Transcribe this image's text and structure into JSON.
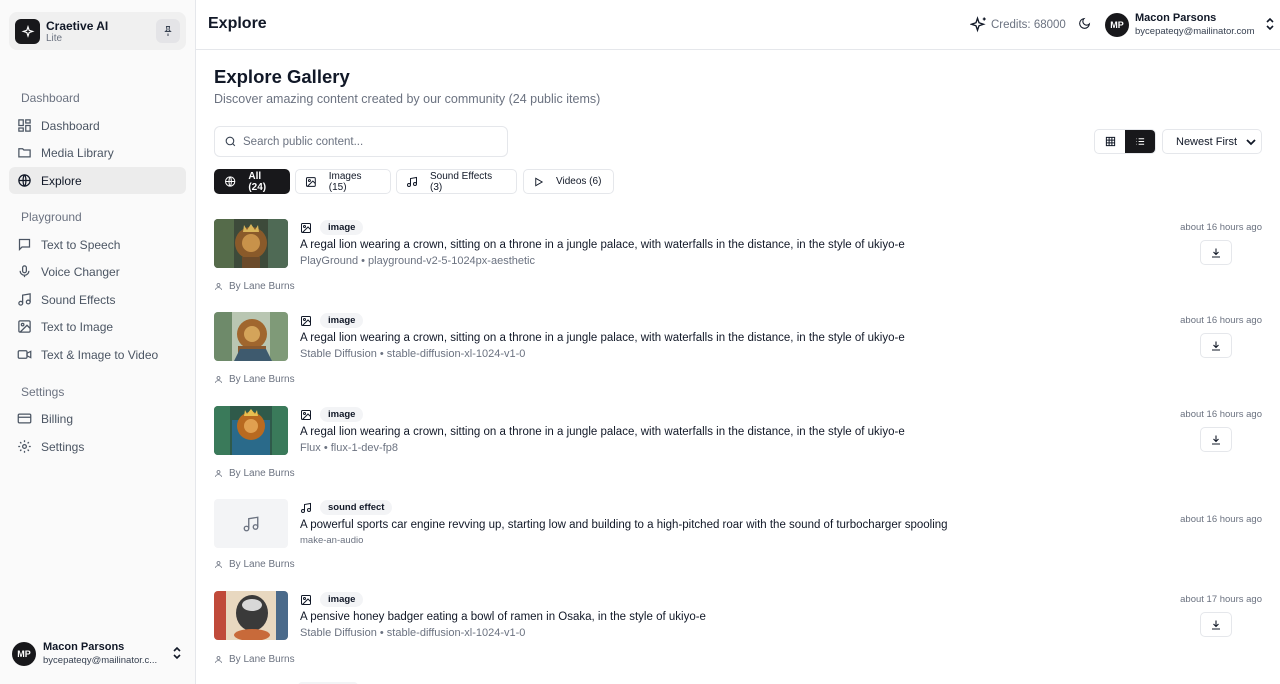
{
  "brand": {
    "name": "Craetive AI",
    "plan": "Lite"
  },
  "sidebar": {
    "sections": [
      {
        "label": "Dashboard",
        "items": [
          {
            "label": "Dashboard",
            "icon": "dashboard-icon"
          },
          {
            "label": "Media Library",
            "icon": "folder-icon"
          },
          {
            "label": "Explore",
            "icon": "globe-icon",
            "active": true
          }
        ]
      },
      {
        "label": "Playground",
        "items": [
          {
            "label": "Text to Speech",
            "icon": "message-icon"
          },
          {
            "label": "Voice Changer",
            "icon": "mic-icon"
          },
          {
            "label": "Sound Effects",
            "icon": "music-icon"
          },
          {
            "label": "Text to Image",
            "icon": "image-icon"
          },
          {
            "label": "Text & Image to Video",
            "icon": "video-icon"
          }
        ]
      },
      {
        "label": "Settings",
        "items": [
          {
            "label": "Billing",
            "icon": "credit-card-icon"
          },
          {
            "label": "Settings",
            "icon": "gear-icon"
          }
        ]
      }
    ]
  },
  "user": {
    "initials": "MP",
    "name": "Macon Parsons",
    "email": "bycepateqy@mailinator.com",
    "email_short": "bycepateqy@mailinator.c..."
  },
  "header": {
    "title": "Explore",
    "credits": "Credits: 68000"
  },
  "gallery": {
    "title": "Explore Gallery",
    "subtitle": "Discover amazing content created by our community (24 public items)",
    "search_placeholder": "Search public content...",
    "sort": "Newest First",
    "filters": [
      {
        "label": "All (24)",
        "icon": "globe-icon",
        "active": true
      },
      {
        "label": "Images (15)",
        "icon": "image-icon"
      },
      {
        "label": "Sound Effects (3)",
        "icon": "music-icon"
      },
      {
        "label": "Videos (6)",
        "icon": "play-icon"
      }
    ]
  },
  "items": [
    {
      "type": "image",
      "prompt": "A regal lion wearing a crown, sitting on a throne in a jungle palace, with waterfalls in the distance, in the style of ukiyo-e",
      "meta": "PlayGround • playground-v2-5-1024px-aesthetic",
      "author": "By Lane Burns",
      "time": "about 16 hours ago"
    },
    {
      "type": "image",
      "prompt": "A regal lion wearing a crown, sitting on a throne in a jungle palace, with waterfalls in the distance, in the style of ukiyo-e",
      "meta": "Stable Diffusion • stable-diffusion-xl-1024-v1-0",
      "author": "By Lane Burns",
      "time": "about 16 hours ago"
    },
    {
      "type": "image",
      "prompt": "A regal lion wearing a crown, sitting on a throne in a jungle palace, with waterfalls in the distance, in the style of ukiyo-e",
      "meta": "Flux • flux-1-dev-fp8",
      "author": "By Lane Burns",
      "time": "about 16 hours ago"
    },
    {
      "type": "sound effect",
      "prompt": "A powerful sports car engine revving up, starting low and building to a high-pitched roar with the sound of turbocharger spooling",
      "meta": "make-an-audio",
      "author": "By Lane Burns",
      "time": "about 16 hours ago"
    },
    {
      "type": "image",
      "prompt": "A pensive honey badger eating a bowl of ramen in Osaka, in the style of ukiyo-e",
      "meta": "Stable Diffusion • stable-diffusion-xl-1024-v1-0",
      "author": "By Lane Burns",
      "time": "about 17 hours ago"
    }
  ]
}
